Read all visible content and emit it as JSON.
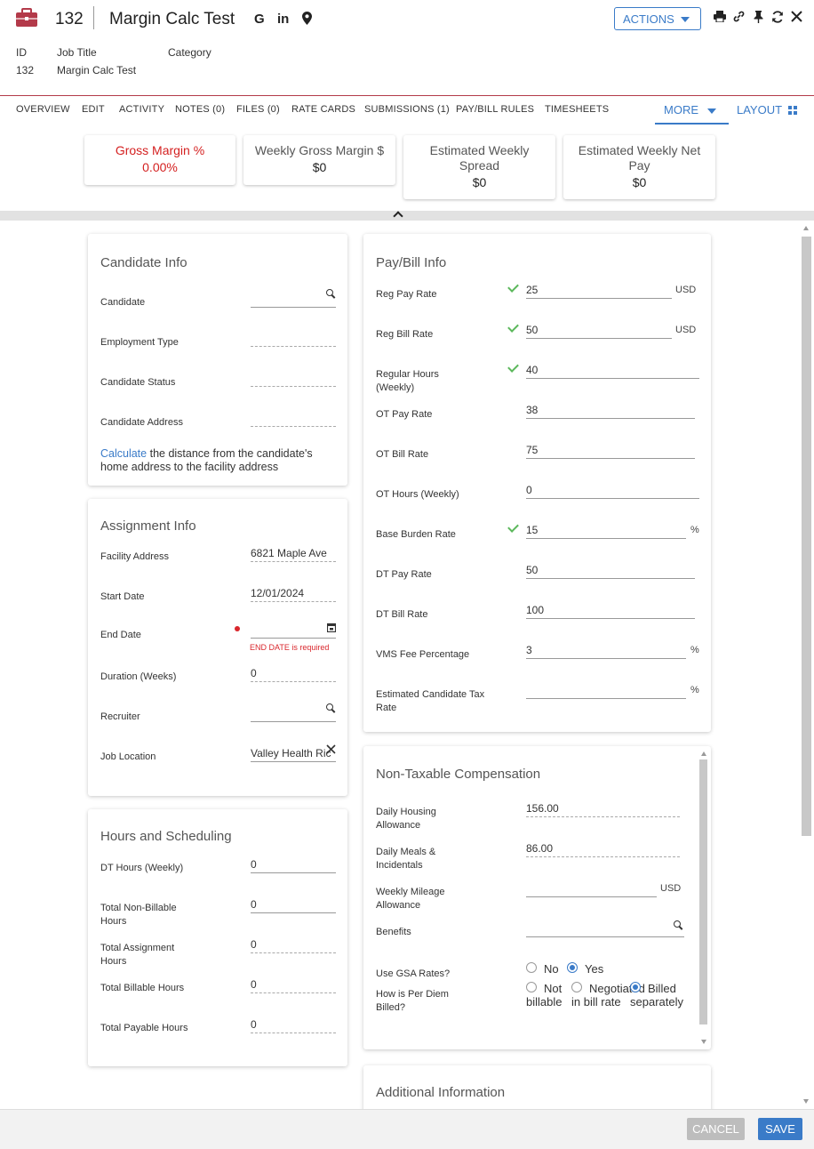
{
  "header": {
    "record_id": "132",
    "title": "Margin Calc Test",
    "actions_label": "ACTIONS",
    "social_icons": [
      "google-icon",
      "linkedin-icon",
      "map-pin-icon"
    ],
    "tool_icons": [
      "print-icon",
      "link-icon",
      "pin-icon",
      "refresh-icon",
      "close-icon"
    ],
    "meta": {
      "id_label": "ID",
      "id_value": "132",
      "job_title_label": "Job Title",
      "job_title_value": "Margin Calc Test",
      "category_label": "Category",
      "category_value": ""
    },
    "brand_color": "#b33a4a"
  },
  "tabs": [
    "OVERVIEW",
    "EDIT",
    "ACTIVITY",
    "NOTES (0)",
    "FILES (0)",
    "RATE CARDS",
    "SUBMISSIONS (1)",
    "PAY/BILL RULES",
    "TIMESHEETS"
  ],
  "tab_more": "MORE",
  "tab_layout": "LAYOUT",
  "summary_cards": [
    {
      "label": "Gross Margin %",
      "value": "0.00%"
    },
    {
      "label": "Weekly Gross Margin $",
      "value": "$0"
    },
    {
      "label": "Estimated Weekly Spread",
      "value": "$0"
    },
    {
      "label": "Estimated Weekly Net Pay",
      "value": "$0"
    }
  ],
  "candidate_info": {
    "title": "Candidate Info",
    "candidate_label": "Candidate",
    "employment_type_label": "Employment Type",
    "candidate_status_label": "Candidate Status",
    "candidate_address_label": "Candidate Address",
    "calc_link": "Calculate",
    "calc_text": " the distance from the candidate's home address to the facility address"
  },
  "assignment_info": {
    "title": "Assignment Info",
    "facility_address_label": "Facility Address",
    "facility_address_value": "6821 Maple Ave",
    "start_date_label": "Start Date",
    "start_date_value": "12/01/2024",
    "end_date_label": "End Date",
    "end_date_value": "",
    "end_date_error": "END DATE is required",
    "duration_label": "Duration (Weeks)",
    "duration_value": "0",
    "recruiter_label": "Recruiter",
    "job_location_label": "Job Location",
    "job_location_value": "Valley Health Ric"
  },
  "hours": {
    "title": "Hours and Scheduling",
    "dt_hours_label": "DT Hours (Weekly)",
    "dt_hours_value": "0",
    "non_billable_label": "Total Non-Billable Hours",
    "non_billable_value": "0",
    "assignment_hours_label": "Total Assignment Hours",
    "assignment_hours_value": "0",
    "billable_label": "Total Billable Hours",
    "billable_value": "0",
    "payable_label": "Total Payable Hours",
    "payable_value": "0"
  },
  "pay_bill": {
    "title": "Pay/Bill Info",
    "reg_pay_label": "Reg Pay Rate",
    "reg_pay_value": "25",
    "reg_pay_unit": "USD",
    "reg_bill_label": "Reg Bill Rate",
    "reg_bill_value": "50",
    "reg_bill_unit": "USD",
    "regular_hours_label": "Regular Hours (Weekly)",
    "regular_hours_value": "40",
    "ot_pay_label": "OT Pay Rate",
    "ot_pay_value": "38",
    "ot_bill_label": "OT Bill Rate",
    "ot_bill_value": "75",
    "ot_hours_label": "OT Hours (Weekly)",
    "ot_hours_value": "0",
    "base_burden_label": "Base Burden Rate",
    "base_burden_value": "15",
    "base_burden_unit": "%",
    "dt_pay_label": "DT Pay Rate",
    "dt_pay_value": "50",
    "dt_bill_label": "DT Bill Rate",
    "dt_bill_value": "100",
    "vms_label": "VMS Fee Percentage",
    "vms_value": "3",
    "vms_unit": "%",
    "tax_label": "Estimated Candidate Tax Rate",
    "tax_value": "",
    "tax_unit": "%"
  },
  "non_taxable": {
    "title": "Non-Taxable Compensation",
    "housing_label": "Daily Housing Allowance",
    "housing_value": "156.00",
    "meals_label": "Daily Meals & Incidentals",
    "meals_value": "86.00",
    "mileage_label": "Weekly Mileage Allowance",
    "mileage_value": "",
    "mileage_unit": "USD",
    "benefits_label": "Benefits",
    "gsa_label": "Use GSA Rates?",
    "gsa_no": "No",
    "gsa_yes": "Yes",
    "gsa_selected": "Yes",
    "per_diem_label": "How is Per Diem Billed?",
    "per_diem_opt1": "Not billable",
    "per_diem_opt2": "Negotiated in bill rate",
    "per_diem_opt3": "Billed separately",
    "per_diem_selected": "Billed separately"
  },
  "additional": {
    "title": "Additional Information"
  },
  "footer": {
    "cancel_label": "CANCEL",
    "save_label": "SAVE"
  },
  "colors": {
    "accent": "#3a7bc8",
    "error": "#d42020",
    "success": "#5cb85c"
  }
}
